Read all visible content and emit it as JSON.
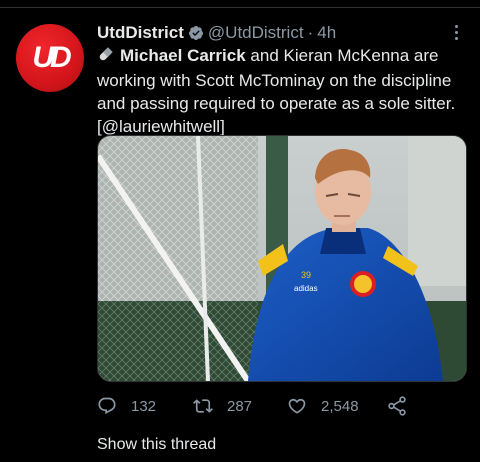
{
  "tweet": {
    "display_name": "UtdDistrict",
    "handle": "@UtdDistrict",
    "separator": "·",
    "time": "4h",
    "text": {
      "emoji_icon": "pill-icon",
      "bold_part": "Michael Carrick",
      "rest": " and Kieran McKenna are working with Scott McTominay on the discipline and passing required to operate as a sole sitter.",
      "source": "[@lauriewhitwell]"
    },
    "media": {
      "shirt_number": "39",
      "sponsor": "adidas"
    },
    "actions": {
      "replies": "132",
      "retweets": "287",
      "likes": "2,548"
    },
    "show_thread": "Show this thread"
  },
  "avatar": {
    "logo_text": "UD"
  },
  "colors": {
    "background": "#000000",
    "text": "#e7e9ea",
    "muted": "#8b98a5",
    "brand_red": "#d3151b",
    "verified": "#8b98a5"
  }
}
